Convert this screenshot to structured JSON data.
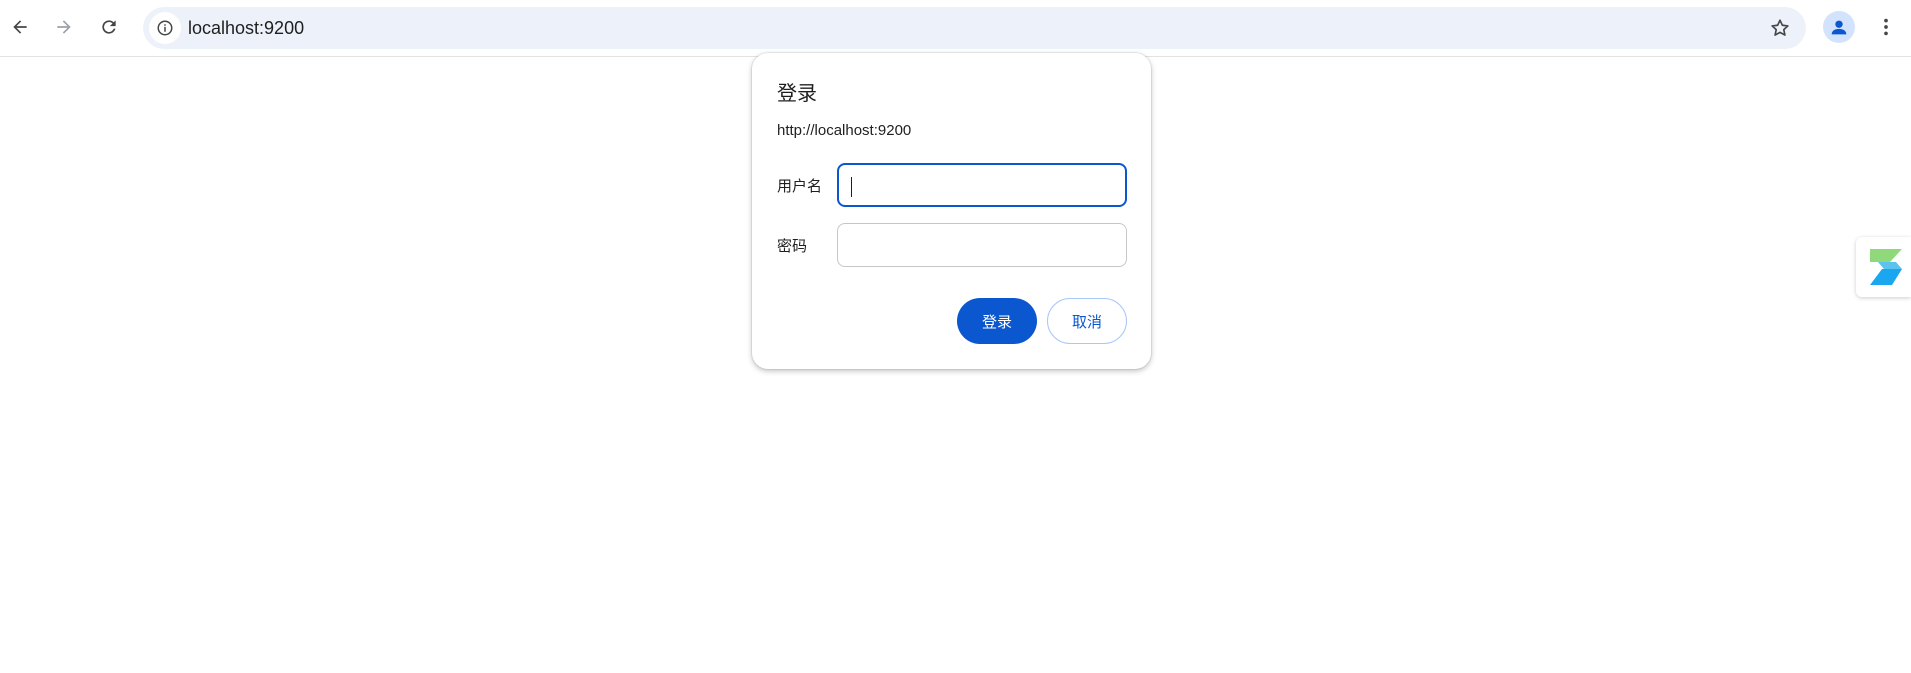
{
  "browser": {
    "url": "localhost:9200",
    "icons": {
      "back": "back-arrow-icon",
      "forward": "forward-arrow-icon",
      "reload": "reload-icon",
      "site_info": "info-icon",
      "bookmark": "star-icon",
      "profile": "profile-icon",
      "menu": "kebab-menu-icon"
    }
  },
  "dialog": {
    "title": "登录",
    "origin": "http://localhost:9200",
    "username_label": "用户名",
    "username_value": "",
    "password_label": "密码",
    "password_value": "",
    "login_button": "登录",
    "cancel_button": "取消"
  },
  "side_extension": {
    "icon": "extension-chevron-icon"
  },
  "colors": {
    "accent": "#0b57d0",
    "omnibox_bg": "#edf2fa",
    "secondary_border": "#a8c7fa",
    "ext_green": "#8fd97a",
    "ext_blue": "#1aa7f0"
  }
}
